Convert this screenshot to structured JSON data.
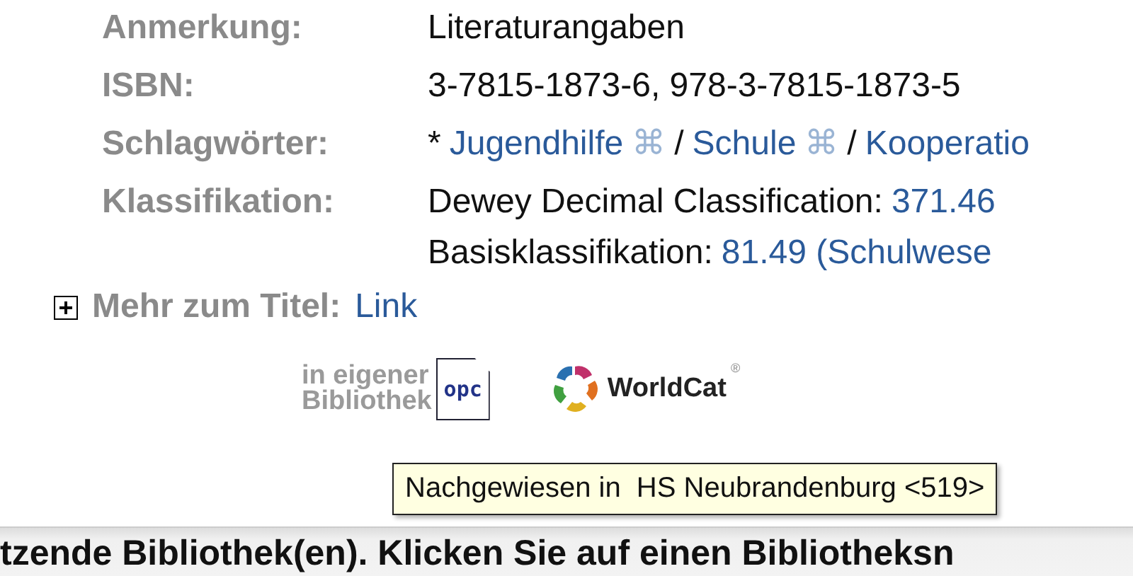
{
  "fields": [
    {
      "label": "Anmerkung:",
      "lines": [
        [
          {
            "kind": "text",
            "text": "Literaturangaben"
          }
        ]
      ]
    },
    {
      "label": "ISBN:",
      "lines": [
        [
          {
            "kind": "text",
            "text": "3-7815-1873-6, 978-3-7815-1873-5"
          }
        ]
      ]
    },
    {
      "label": "Schlagwörter:",
      "lines": [
        [
          {
            "kind": "text",
            "text": "*"
          },
          {
            "kind": "link",
            "text": "Jugendhilfe"
          },
          {
            "kind": "symbol",
            "text": "⌘"
          },
          {
            "kind": "text",
            "text": "/"
          },
          {
            "kind": "link",
            "text": "Schule"
          },
          {
            "kind": "symbol",
            "text": "⌘"
          },
          {
            "kind": "text",
            "text": "/"
          },
          {
            "kind": "link",
            "text": "Kooperatio"
          }
        ]
      ]
    },
    {
      "label": "Klassifikation:",
      "lines": [
        [
          {
            "kind": "text",
            "text": "Dewey Decimal Classification:"
          },
          {
            "kind": "link",
            "text": "371.46"
          }
        ],
        [
          {
            "kind": "text",
            "text": "Basisklassifikation:"
          },
          {
            "kind": "link",
            "text": "81.49 (Schulwese"
          }
        ]
      ]
    }
  ],
  "more": {
    "label": "Mehr zum Titel:",
    "link": "Link",
    "expanded": false
  },
  "own_library": {
    "text_1": "in eigener",
    "text_2": "Bibliothek",
    "icon_text": "opc"
  },
  "worldcat": {
    "text": "WorldCat",
    "mark": "®"
  },
  "bottom_bar": {
    "text": "tzende Bibliothek(en). Klicken Sie auf einen Bibliotheksn"
  },
  "tooltip": {
    "text": "Nachgewiesen in  HS Neubrandenburg <519>"
  }
}
